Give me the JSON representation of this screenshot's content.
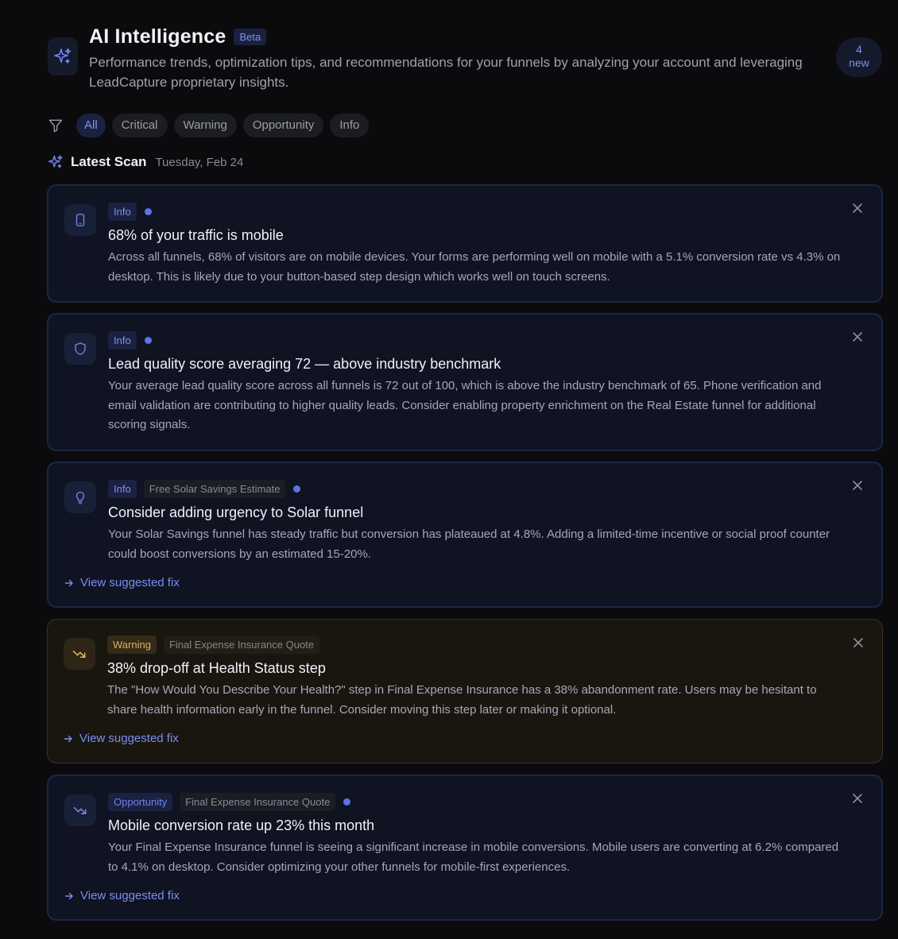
{
  "header": {
    "title": "AI Intelligence",
    "beta_label": "Beta",
    "subtitle": "Performance trends, optimization tips, and recommendations for your funnels by analyzing your account and leveraging LeadCapture proprietary insights.",
    "new_count": "4",
    "new_label": "new",
    "icon": "sparkles-icon"
  },
  "filters": {
    "icon": "filter-icon",
    "chips": [
      "All",
      "Critical",
      "Warning",
      "Opportunity",
      "Info"
    ],
    "active": "All"
  },
  "scan": {
    "title": "Latest Scan",
    "date": "Tuesday, Feb 24"
  },
  "cards": [
    {
      "type": "Info",
      "funnel": "",
      "icon": "smartphone-icon",
      "title": "68% of your traffic is mobile",
      "body": "Across all funnels, 68% of visitors are on mobile devices. Your forms are performing well on mobile with a 5.1% conversion rate vs 4.3% on desktop. This is likely due to your button-based step design which works well on touch screens.",
      "fix": ""
    },
    {
      "type": "Info",
      "funnel": "",
      "icon": "shield-icon",
      "title": "Lead quality score averaging 72 — above industry benchmark",
      "body": "Your average lead quality score across all funnels is 72 out of 100, which is above the industry benchmark of 65. Phone verification and email validation are contributing to higher quality leads. Consider enabling property enrichment on the Real Estate funnel for additional scoring signals.",
      "fix": ""
    },
    {
      "type": "Info",
      "funnel": "Free Solar Savings Estimate",
      "icon": "lightbulb-icon",
      "title": "Consider adding urgency to Solar funnel",
      "body": "Your Solar Savings funnel has steady traffic but conversion has plateaued at 4.8%. Adding a limited-time incentive or social proof counter could boost conversions by an estimated 15-20%.",
      "fix": "View suggested fix"
    },
    {
      "type": "Warning",
      "funnel": "Final Expense Insurance Quote",
      "icon": "trending-down-icon",
      "title": "38% drop-off at Health Status step",
      "body": "The \"How Would You Describe Your Health?\" step in Final Expense Insurance has a 38% abandonment rate. Users may be hesitant to share health information early in the funnel. Consider moving this step later or making it optional.",
      "fix": "View suggested fix"
    },
    {
      "type": "Opportunity",
      "funnel": "Final Expense Insurance Quote",
      "icon": "trending-down-icon",
      "title": "Mobile conversion rate up 23% this month",
      "body": "Your Final Expense Insurance funnel is seeing a significant increase in mobile conversions. Mobile users are converting at 6.2% compared to 4.1% on desktop. Consider optimizing your other funnels for mobile-first experiences.",
      "fix": "View suggested fix"
    }
  ],
  "colors": {
    "background": "#0b0b0d",
    "accent": "#7e8ff0",
    "warning": "#dcb161",
    "unread_dot": "#5e72e4"
  }
}
